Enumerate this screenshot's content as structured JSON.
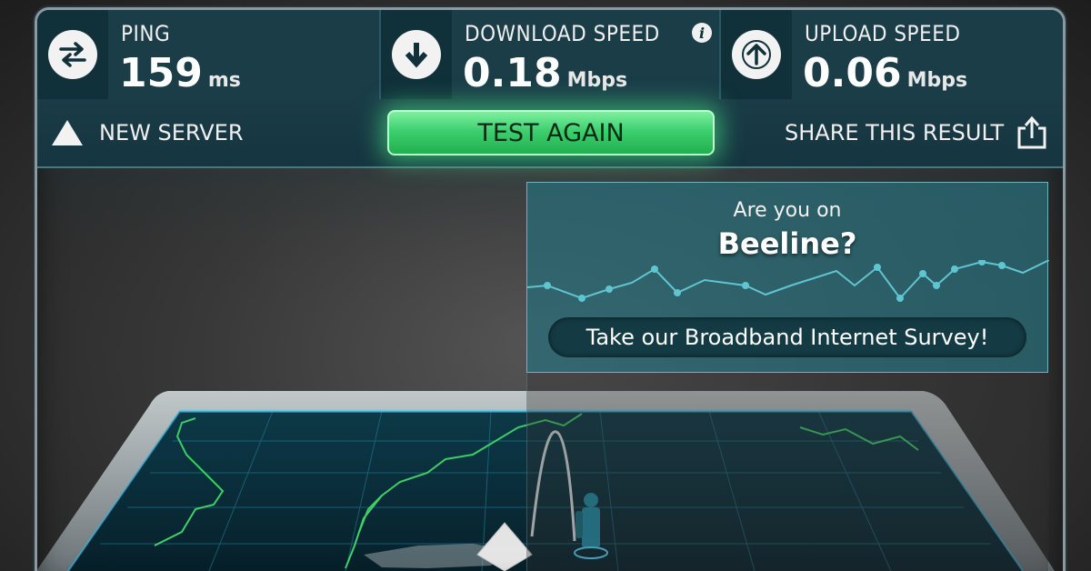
{
  "stats": {
    "ping": {
      "label": "PING",
      "value": "159",
      "unit": "ms"
    },
    "download": {
      "label": "DOWNLOAD SPEED",
      "value": "0.18",
      "unit": "Mbps"
    },
    "upload": {
      "label": "UPLOAD SPEED",
      "value": "0.06",
      "unit": "Mbps"
    }
  },
  "actions": {
    "new_server": "NEW SERVER",
    "test_again": "TEST AGAIN",
    "share": "SHARE THIS RESULT"
  },
  "survey": {
    "question": "Are you on",
    "isp": "Beeline?",
    "cta": "Take our Broadband Internet Survey!"
  },
  "colors": {
    "accent_green": "#3ecf6f",
    "panel_teal": "#153540",
    "map_line": "#3fd66a",
    "grid": "#2aa0c0"
  },
  "icons": {
    "ping": "swap-arrows-icon",
    "download": "download-arrow-icon",
    "upload": "upload-arrow-icon",
    "info": "info-icon",
    "new_server": "server-triangle-icon",
    "share": "share-icon"
  }
}
